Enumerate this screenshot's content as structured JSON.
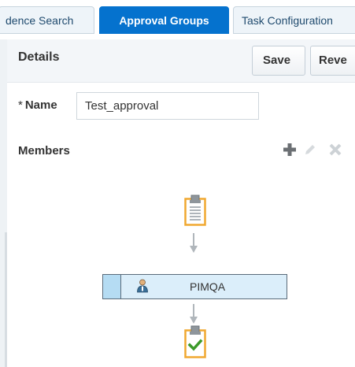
{
  "tabs": [
    {
      "label": "dence Search",
      "active": false
    },
    {
      "label": "Approval Groups",
      "active": true
    },
    {
      "label": "Task Configuration",
      "active": false
    }
  ],
  "details": {
    "title": "Details",
    "save_label": "Save",
    "revert_label": "Reve"
  },
  "name_field": {
    "required_marker": "*",
    "label": "Name",
    "value": "Test_approval"
  },
  "members": {
    "title": "Members",
    "toolbar_icons": [
      "add-icon",
      "edit-icon",
      "delete-icon"
    ],
    "items": [
      {
        "label": "PIMQA",
        "icon": "user-icon"
      }
    ]
  },
  "colors": {
    "active_tab": "#0572ce",
    "clipboard_outline": "#f0a830",
    "check_green": "#3c9a2a",
    "member_row_fill": "#dbeefa"
  }
}
